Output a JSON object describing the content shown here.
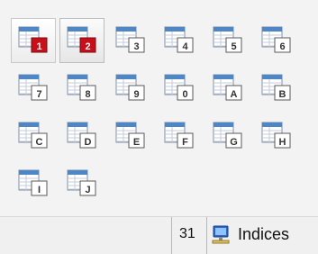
{
  "toolbar": {
    "buttons": [
      {
        "label": "1",
        "style": "red",
        "selected": true
      },
      {
        "label": "2",
        "style": "red",
        "selected": true
      },
      {
        "label": "3",
        "style": "plain"
      },
      {
        "label": "4",
        "style": "plain"
      },
      {
        "label": "5",
        "style": "plain"
      },
      {
        "label": "6",
        "style": "plain"
      },
      {
        "label": "7",
        "style": "plain"
      },
      {
        "label": "8",
        "style": "plain"
      },
      {
        "label": "9",
        "style": "plain"
      },
      {
        "label": "0",
        "style": "plain"
      },
      {
        "label": "A",
        "style": "plain"
      },
      {
        "label": "B",
        "style": "plain"
      },
      {
        "label": "C",
        "style": "plain"
      },
      {
        "label": "D",
        "style": "plain"
      },
      {
        "label": "E",
        "style": "plain"
      },
      {
        "label": "F",
        "style": "plain"
      },
      {
        "label": "G",
        "style": "plain"
      },
      {
        "label": "H",
        "style": "plain"
      },
      {
        "label": "I",
        "style": "plain"
      },
      {
        "label": "J",
        "style": "plain"
      }
    ],
    "icon": "table-icon"
  },
  "statusbar": {
    "count": "31",
    "icon": "network-computer-icon",
    "label": "Indices"
  },
  "colors": {
    "table_header": "#4f86c6",
    "badge_red": "#c8101a",
    "badge_plain_bg": "#ffffff",
    "badge_plain_border": "#5a5a5a"
  }
}
